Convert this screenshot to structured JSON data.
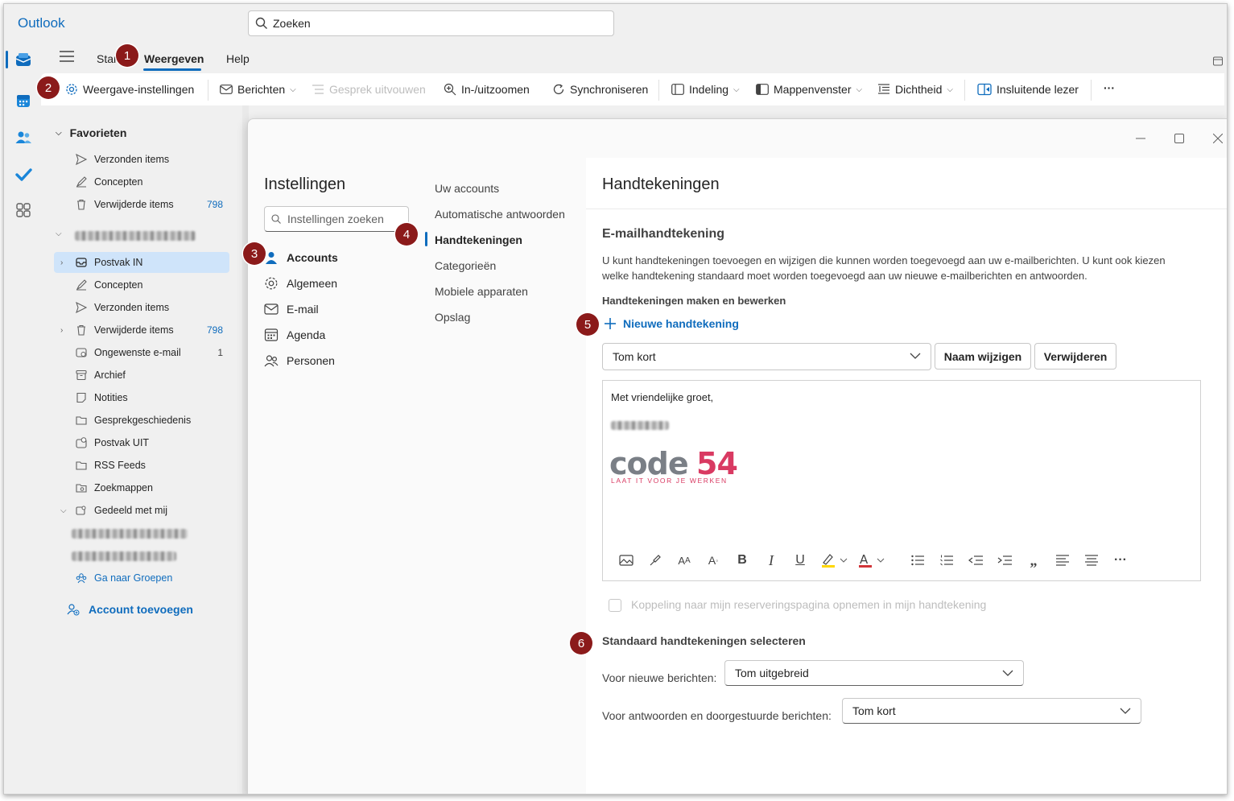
{
  "app": {
    "title": "Outlook"
  },
  "search": {
    "placeholder": "Zoeken"
  },
  "rail": {
    "items": [
      "mail-icon",
      "calendar-icon",
      "people-icon",
      "todo-icon",
      "apps-icon"
    ]
  },
  "tabs": {
    "start": "Start",
    "view": "Weergeven",
    "help": "Help"
  },
  "ribbon": {
    "view_settings": "Weergave-instellingen",
    "messages": "Berichten",
    "expand_conversation": "Gesprek uitvouwen",
    "zoom": "In-/uitzoomen",
    "sync": "Synchroniseren",
    "layout": "Indeling",
    "folder_pane": "Mappenvenster",
    "density": "Dichtheid",
    "immersive_reader": "Insluitende lezer",
    "more": "···"
  },
  "folders": {
    "favorites_header": "Favorieten",
    "favorites": [
      {
        "label": "Verzonden items",
        "count": ""
      },
      {
        "label": "Concepten",
        "count": ""
      },
      {
        "label": "Verwijderde items",
        "count": "798"
      }
    ],
    "account_items": [
      {
        "label": "Postvak IN",
        "count": ""
      },
      {
        "label": "Concepten",
        "count": ""
      },
      {
        "label": "Verzonden items",
        "count": ""
      },
      {
        "label": "Verwijderde items",
        "count": "798"
      },
      {
        "label": "Ongewenste e-mail",
        "count": "1"
      },
      {
        "label": "Archief",
        "count": ""
      },
      {
        "label": "Notities",
        "count": ""
      },
      {
        "label": "Gesprekgeschiedenis",
        "count": ""
      },
      {
        "label": "Postvak UIT",
        "count": ""
      },
      {
        "label": "RSS Feeds",
        "count": ""
      },
      {
        "label": "Zoekmappen",
        "count": ""
      },
      {
        "label": "Gedeeld met mij",
        "count": ""
      }
    ],
    "go_to_groups": "Ga naar Groepen",
    "add_account": "Account toevoegen"
  },
  "settings": {
    "title": "Instellingen",
    "search_placeholder": "Instellingen zoeken",
    "categories": [
      "Accounts",
      "Algemeen",
      "E-mail",
      "Agenda",
      "Personen"
    ],
    "subcategories": [
      "Uw accounts",
      "Automatische antwoorden",
      "Handtekeningen",
      "Categorieën",
      "Mobiele apparaten",
      "Opslag"
    ]
  },
  "pane": {
    "title": "Handtekeningen",
    "section_title": "E-mailhandtekening",
    "description": "U kunt handtekeningen toevoegen en wijzigen die kunnen worden toegevoegd aan uw e-mailberichten. U kunt ook kiezen welke handtekening standaard moet worden toegevoegd aan uw nieuwe e-mailberichten en antwoorden.",
    "make_label": "Handtekeningen maken en bewerken",
    "new_signature": "Nieuwe handtekening",
    "selected_signature": "Tom kort",
    "rename": "Naam wijzigen",
    "delete": "Verwijderen",
    "greeting": "Met vriendelijke groet,",
    "logo_text": "code54",
    "logo_tagline": "LAAT IT VOOR JE WERKEN",
    "booking_checkbox": "Koppeling naar mijn reserveringspagina opnemen in mijn handtekening",
    "defaults_title": "Standaard handtekeningen selecteren",
    "new_messages_label": "Voor nieuwe berichten:",
    "new_messages_value": "Tom uitgebreid",
    "replies_label": "Voor antwoorden en doorgestuurde berichten:",
    "replies_value": "Tom kort"
  },
  "badges": [
    "1",
    "2",
    "3",
    "4",
    "5",
    "6"
  ],
  "colors": {
    "accent": "#0f6cbd",
    "badge": "#8b1a1a",
    "logo_grey": "#7a7f86",
    "logo_pink": "#d93a62"
  }
}
